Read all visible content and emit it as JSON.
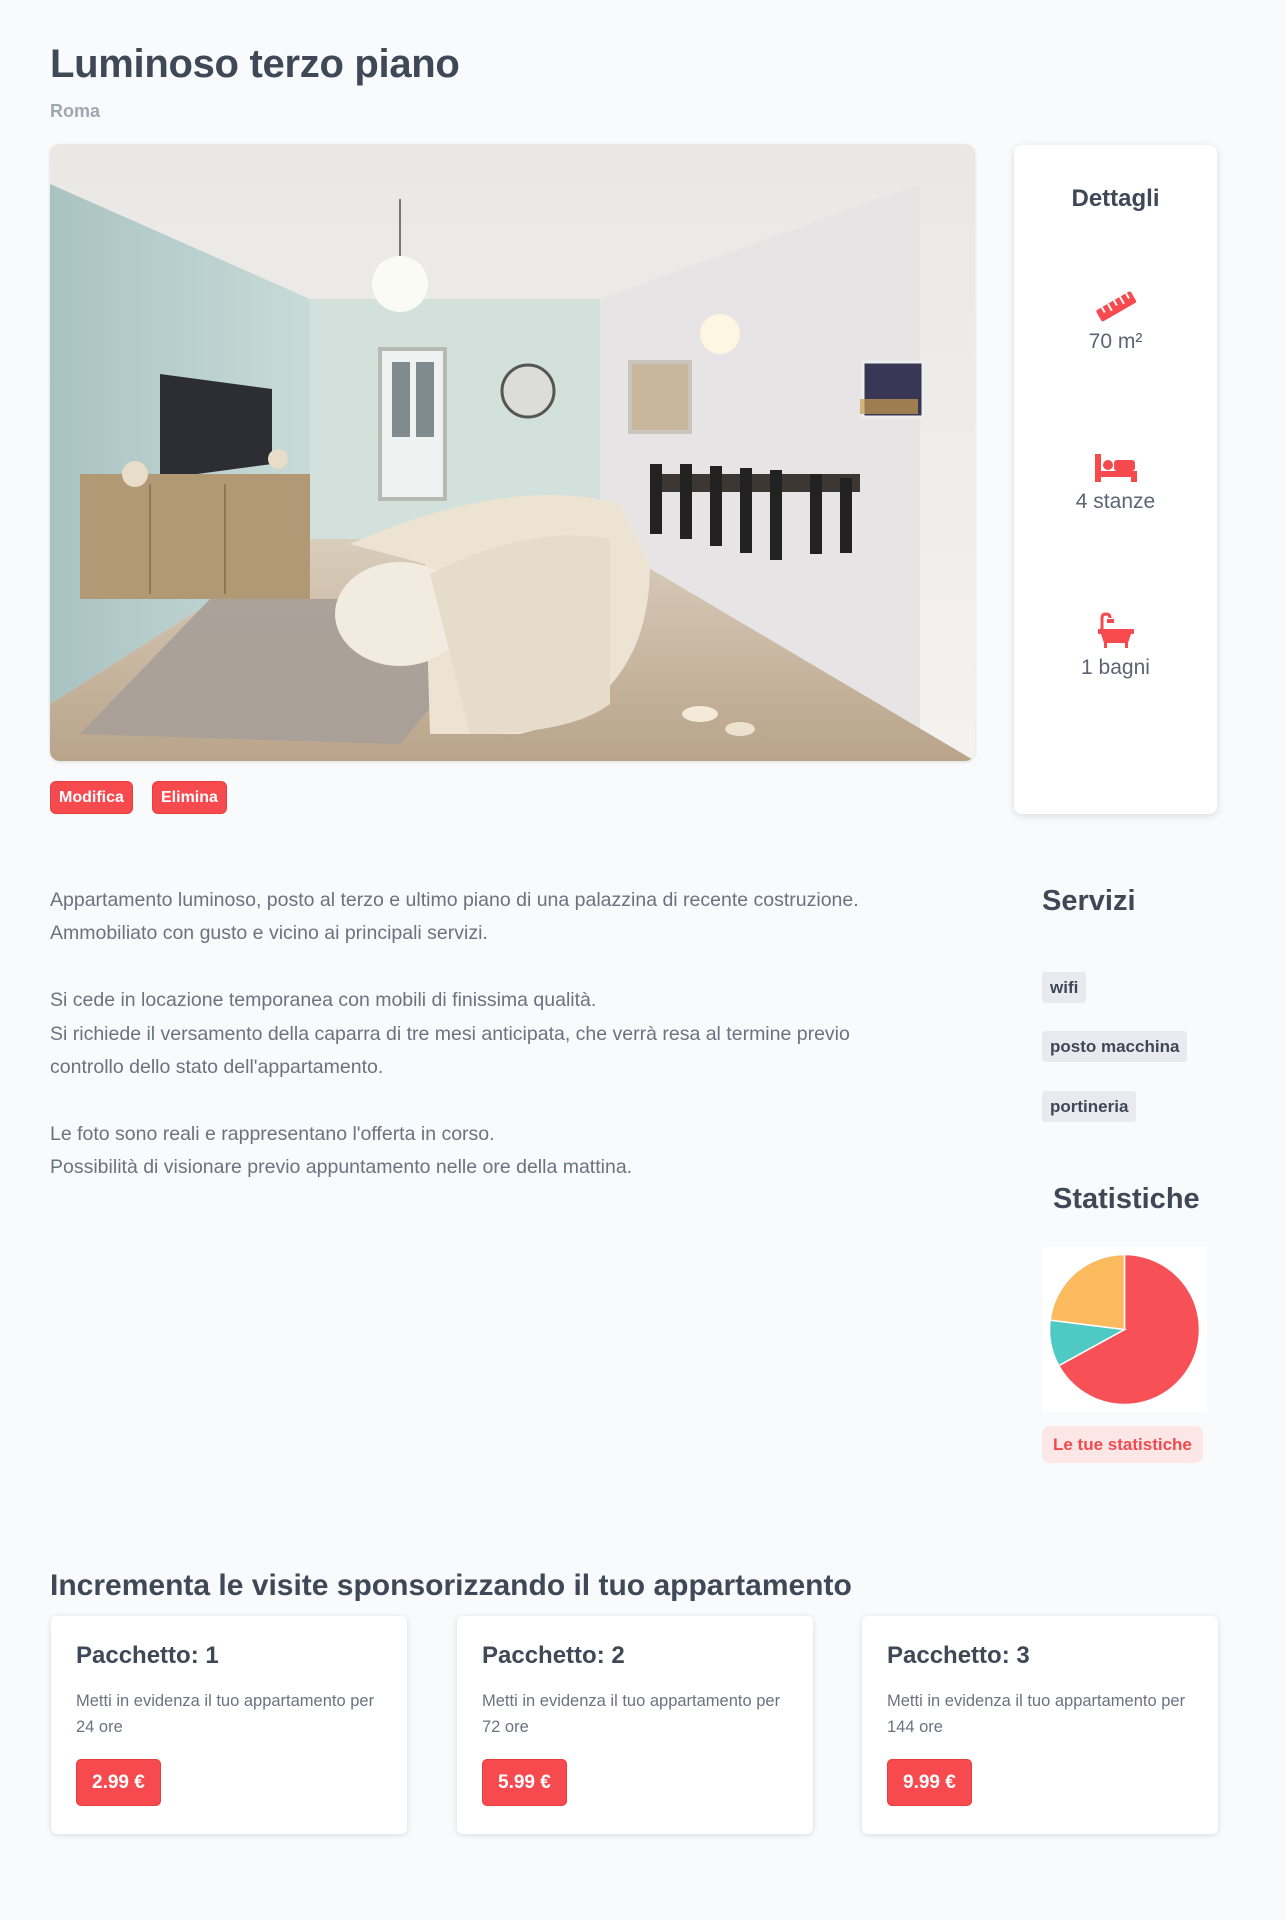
{
  "apartment": {
    "title": "Luminoso terzo piano",
    "city": "Roma",
    "photo_icon": "living-room-photo"
  },
  "actions": {
    "edit_label": "Modifica",
    "delete_label": "Elimina"
  },
  "details": {
    "heading": "Dettagli",
    "items": [
      {
        "icon": "ruler-icon",
        "text": "70 m²"
      },
      {
        "icon": "bed-icon",
        "text": "4 stanze"
      },
      {
        "icon": "bathtub-icon",
        "text": "1 bagni"
      }
    ]
  },
  "description": {
    "lines": [
      "Appartamento luminoso, posto al terzo e ultimo piano di una palazzina di recente costruzione.",
      "Ammobiliato con gusto e vicino ai principali servizi.",
      "",
      "Si cede in locazione temporanea con mobili di finissima qualità.",
      "Si richiede il versamento della caparra di tre mesi anticipata, che verrà resa al termine previo",
      "controllo dello stato dell'appartamento.",
      "",
      "Le foto sono reali e rappresentano l'offerta in corso.",
      "Possibilità di visionare previo appuntamento nelle ore della mattina."
    ]
  },
  "services": {
    "heading": "Servizi",
    "items": [
      "wifi",
      "posto macchina",
      "portineria"
    ]
  },
  "stats": {
    "heading": "Statistiche",
    "button_label": "Le tue statistiche"
  },
  "chart_data": {
    "type": "pie",
    "values": [
      0.67,
      0.1,
      0.23
    ],
    "colors": [
      "#f75157",
      "#4fc9c4",
      "#fbba5e"
    ],
    "start_angle_deg": 0
  },
  "promotion": {
    "heading": "Incrementa le visite sponsorizzando il tuo appartamento",
    "package_prefix": "Pacchetto:",
    "packages": [
      {
        "number": "1",
        "description": "Metti in evidenza il tuo appartamento per 24 ore",
        "price": "2.99 €"
      },
      {
        "number": "2",
        "description": "Metti in evidenza il tuo appartamento per 72 ore",
        "price": "5.99 €"
      },
      {
        "number": "3",
        "description": "Metti in evidenza il tuo appartamento per 144 ore",
        "price": "9.99 €"
      }
    ]
  },
  "colors": {
    "accent": "#f64a4f",
    "heading": "#3f4856",
    "text": "#6b7280",
    "background": "#f9fafb",
    "tag_bg": "#e8eaef"
  }
}
